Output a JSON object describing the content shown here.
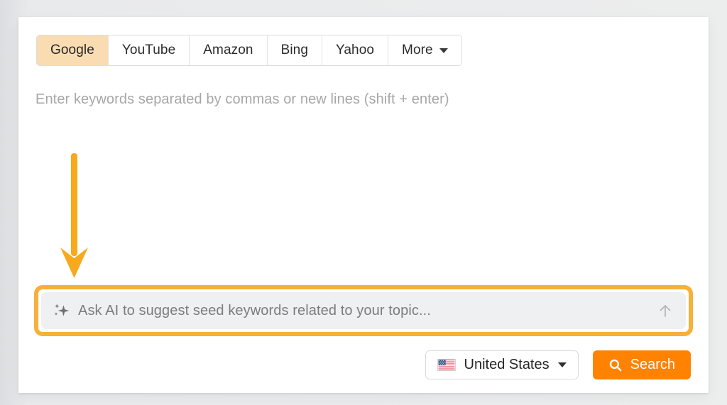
{
  "colors": {
    "page_background": "#e9eaec",
    "card_background": "#ffffff",
    "active_tab_background": "#fadcb3",
    "highlight_border": "#f7b03a",
    "annotation_arrow": "#f8a91c",
    "search_button": "#ff8200",
    "ai_input_background": "#eff0f1",
    "placeholder_text": "#a7a7a7"
  },
  "engine_tabs": {
    "items": [
      {
        "label": "Google",
        "active": true,
        "icon": ""
      },
      {
        "label": "YouTube",
        "active": false,
        "icon": ""
      },
      {
        "label": "Amazon",
        "active": false,
        "icon": ""
      },
      {
        "label": "Bing",
        "active": false,
        "icon": ""
      },
      {
        "label": "Yahoo",
        "active": false,
        "icon": ""
      },
      {
        "label": "More",
        "active": false,
        "icon": "chevron-down-icon"
      }
    ]
  },
  "keywords_field": {
    "value": "",
    "placeholder": "Enter keywords separated by commas or new lines (shift + enter)"
  },
  "annotation": {
    "arrow": "down-arrow-annotation",
    "direction": "down"
  },
  "ai_bar": {
    "sparkle_icon": "ai-sparkle-icon",
    "value": "",
    "placeholder": "Ask AI to suggest seed keywords related to your topic...",
    "submit_icon": "arrow-up-icon",
    "highlighted": true
  },
  "controls": {
    "country": {
      "label": "United States",
      "flag_icon": "us-flag-icon",
      "caret_icon": "chevron-down-icon"
    },
    "search": {
      "label": "Search",
      "icon": "search-icon"
    }
  }
}
